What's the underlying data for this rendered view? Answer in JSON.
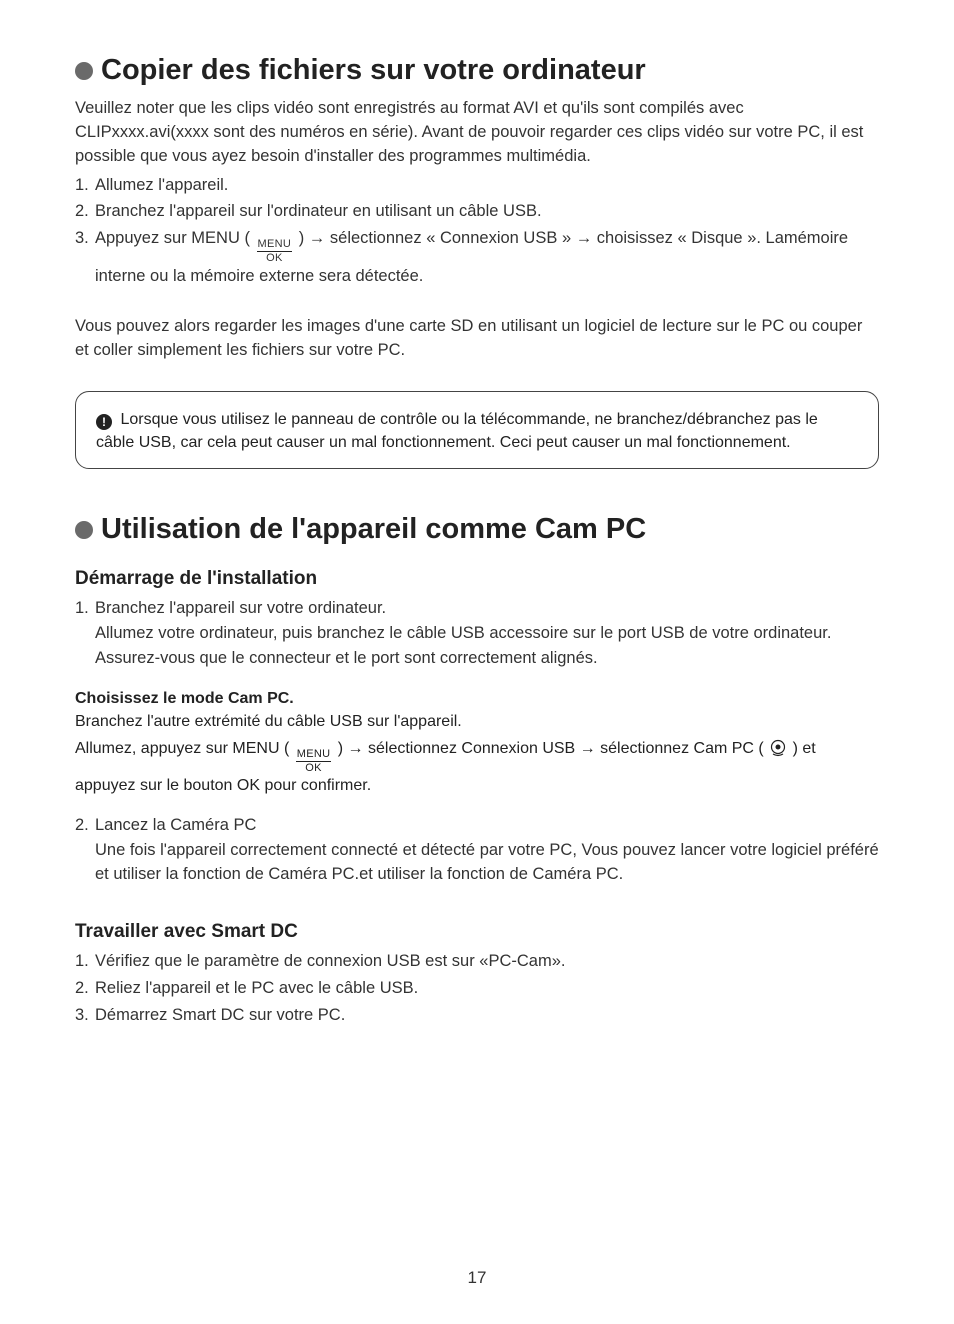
{
  "section1": {
    "title": "Copier des fichiers sur votre ordinateur",
    "intro": "Veuillez noter que les clips vidéo sont enregistrés au format AVI et qu'ils sont compilés avec CLIPxxxx.avi(xxxx sont des numéros en série). Avant de pouvoir regarder ces clips vidéo sur votre PC, il est possible que vous ayez besoin d'installer des programmes multimédia.",
    "steps": {
      "s1_num": "1.",
      "s1": "Allumez l'appareil.",
      "s2_num": "2.",
      "s2": "Branchez l'appareil sur l'ordinateur en utilisant un câble USB.",
      "s3_num": "3.",
      "s3a": "Appuyez sur MENU ( ",
      "s3b": " ) → sélectionnez « Connexion USB » → choisissez « Disque ». Lamémoire interne ou la mémoire externe sera détectée."
    },
    "after": "Vous pouvez alors regarder les images d'une carte SD en utilisant un logiciel de lecture sur le PC ou couper et coller simplement les fichiers sur votre PC.",
    "note": " Lorsque vous utilisez le panneau de contrôle ou la télécommande, ne branchez/débranchez pas le câble USB, car cela peut causer un mal fonctionnement. Ceci peut causer un mal fonctionnement."
  },
  "section2": {
    "title": "Utilisation de l'appareil comme Cam PC",
    "sub1": "Démarrage de l'installation",
    "steps1": {
      "s1_num": "1.",
      "s1": "Branchez l'appareil sur votre ordinateur.",
      "s1b": "Allumez votre ordinateur, puis branchez le câble USB accessoire sur le port USB de votre ordinateur. Assurez-vous que le connecteur et le port sont correctement alignés."
    },
    "mode_heading": "Choisissez le mode Cam PC.",
    "mode_line1": "Branchez l'autre extrémité du câble USB sur l'appareil.",
    "mode_line2a": "Allumez, appuyez sur MENU ( ",
    "mode_line2b": " ) → sélectionnez Connexion USB → sélectionnez Cam PC ( ",
    "mode_line2c": " ) et appuyez sur le bouton OK pour confirmer.",
    "steps1b": {
      "s2_num": "2.",
      "s2": "Lancez la Caméra PC",
      "s2b": "Une fois l'appareil correctement connecté et détecté par votre PC, Vous pouvez lancer votre logiciel préféré et utiliser la fonction de Caméra PC.et utiliser la fonction de Caméra PC."
    },
    "sub2": "Travailler avec Smart DC",
    "steps2": {
      "s1_num": "1.",
      "s1": "Vérifiez que le paramètre de connexion USB est sur «PC-Cam».",
      "s2_num": "2.",
      "s2": "Reliez l'appareil et le PC avec le câble USB.",
      "s3_num": "3.",
      "s3": "Démarrez Smart DC sur votre PC."
    }
  },
  "menu_icon": {
    "top": "MENU",
    "bot": "OK"
  },
  "page_number": "17"
}
